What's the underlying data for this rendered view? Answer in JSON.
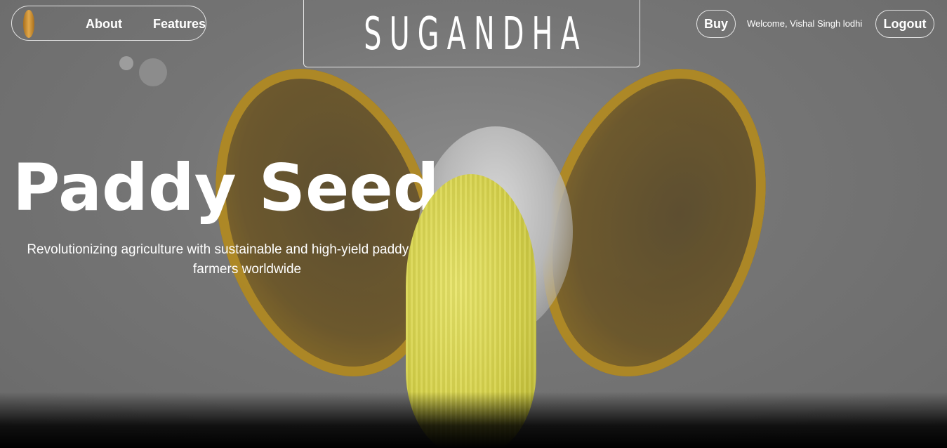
{
  "nav": {
    "logo_icon": "rice-grain-icon",
    "about_label": "About",
    "features_label": "Features"
  },
  "brand": {
    "name": "SUGANDHA"
  },
  "header_right": {
    "buy_label": "Buy",
    "welcome_text": "Welcome, Vishal Singh lodhi",
    "logout_label": "Logout"
  },
  "hero": {
    "title": "Paddy Seed",
    "subtitle": "Revolutionizing agriculture with sustainable and high-yield paddy seeds for farmers worldwide"
  },
  "colors": {
    "text": "#ffffff",
    "background": "#757575",
    "seed": "#d6d24a",
    "husk": "#b38a1e"
  }
}
